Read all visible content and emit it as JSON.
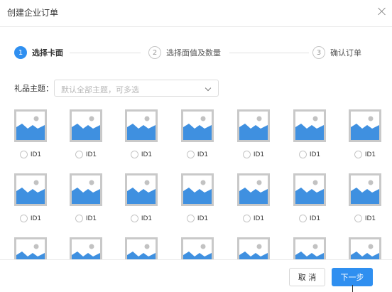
{
  "dialog": {
    "title": "创建企业订单"
  },
  "steps": [
    {
      "number": "1",
      "label": "选择卡面",
      "active": true
    },
    {
      "number": "2",
      "label": "选择面值及数量",
      "active": false
    },
    {
      "number": "3",
      "label": "确认订单",
      "active": false
    }
  ],
  "filter": {
    "label": "礼品主题：",
    "placeholder": "默认全部主题，可多选"
  },
  "cards": [
    {
      "id": "ID1"
    },
    {
      "id": "ID1"
    },
    {
      "id": "ID1"
    },
    {
      "id": "ID1"
    },
    {
      "id": "ID1"
    },
    {
      "id": "ID1"
    },
    {
      "id": "ID1"
    },
    {
      "id": "ID1"
    },
    {
      "id": "ID1"
    },
    {
      "id": "ID1"
    },
    {
      "id": "ID1"
    },
    {
      "id": "ID1"
    },
    {
      "id": "ID1"
    },
    {
      "id": "ID1"
    },
    {
      "id": ""
    },
    {
      "id": ""
    },
    {
      "id": ""
    },
    {
      "id": ""
    },
    {
      "id": ""
    },
    {
      "id": ""
    },
    {
      "id": ""
    }
  ],
  "footer": {
    "cancel_label": "取 消",
    "next_label": "下一步"
  },
  "colors": {
    "primary": "#2f8ff0",
    "thumb_frame": "#c9c9c9",
    "thumb_sky": "#ffffff",
    "thumb_mountain": "#3f90e0",
    "thumb_sun": "#c2c2c2"
  },
  "icons": {
    "close": "close-icon",
    "dropdown": "chevron-down-icon",
    "card_image": "image-placeholder-icon"
  }
}
